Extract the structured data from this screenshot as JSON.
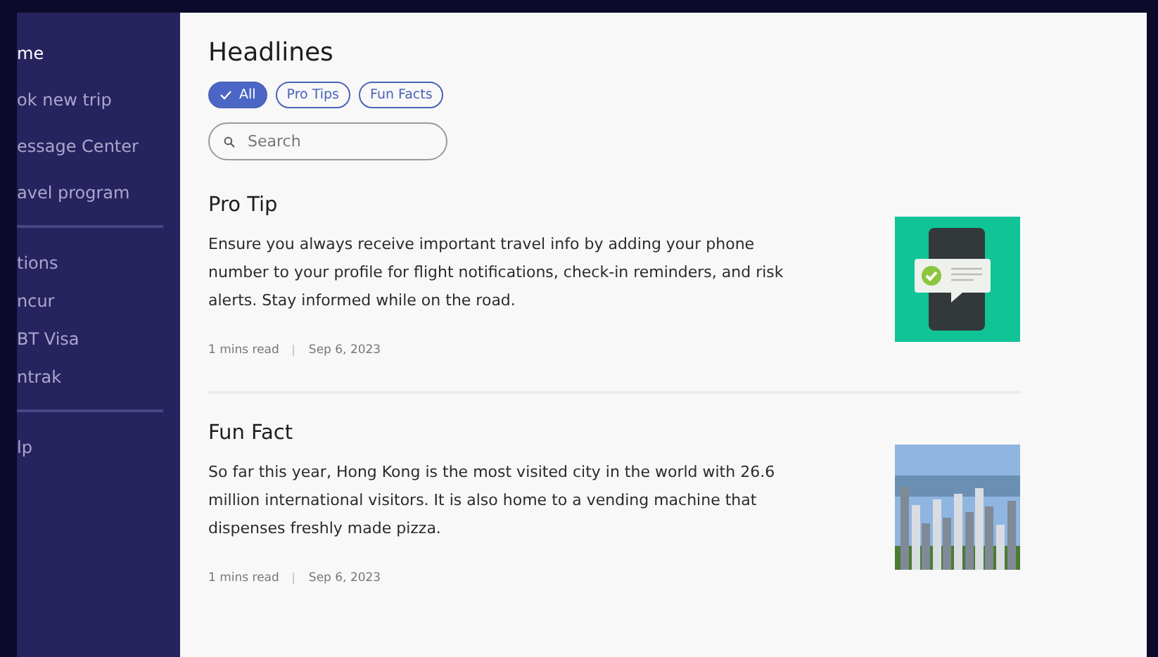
{
  "sidebar": {
    "groups": [
      {
        "items": [
          {
            "label": "me",
            "selected": true
          },
          {
            "label": "ok new trip",
            "selected": false
          },
          {
            "label": "essage Center",
            "selected": false
          },
          {
            "label": "avel program",
            "selected": false
          }
        ]
      },
      {
        "items": [
          {
            "label": "tions",
            "selected": false
          },
          {
            "label": "ncur",
            "selected": false
          },
          {
            "label": "BT Visa",
            "selected": false
          },
          {
            "label": "ntrak",
            "selected": false
          }
        ]
      },
      {
        "items": [
          {
            "label": "lp",
            "selected": false
          }
        ]
      }
    ]
  },
  "main": {
    "title": "Headlines",
    "filters": [
      {
        "label": "All",
        "selected": true
      },
      {
        "label": "Pro Tips",
        "selected": false
      },
      {
        "label": "Fun Facts",
        "selected": false
      }
    ],
    "search": {
      "placeholder": "Search"
    },
    "articles": [
      {
        "kind": "phone",
        "title": "Pro Tip",
        "body": "Ensure you always receive important travel info by adding your phone number to your profile for flight notifications, check-in reminders, and risk alerts. Stay informed while on the road.",
        "read_time": "1 mins read",
        "date": "Sep 6, 2023"
      },
      {
        "kind": "photo",
        "title": "Fun Fact",
        "body": "So far this year, Hong Kong is the most visited city in the world with 26.6 million international visitors. It is also home to a vending machine that dispenses freshly made pizza.",
        "read_time": "1 mins read",
        "date": "Sep 6, 2023"
      }
    ]
  }
}
